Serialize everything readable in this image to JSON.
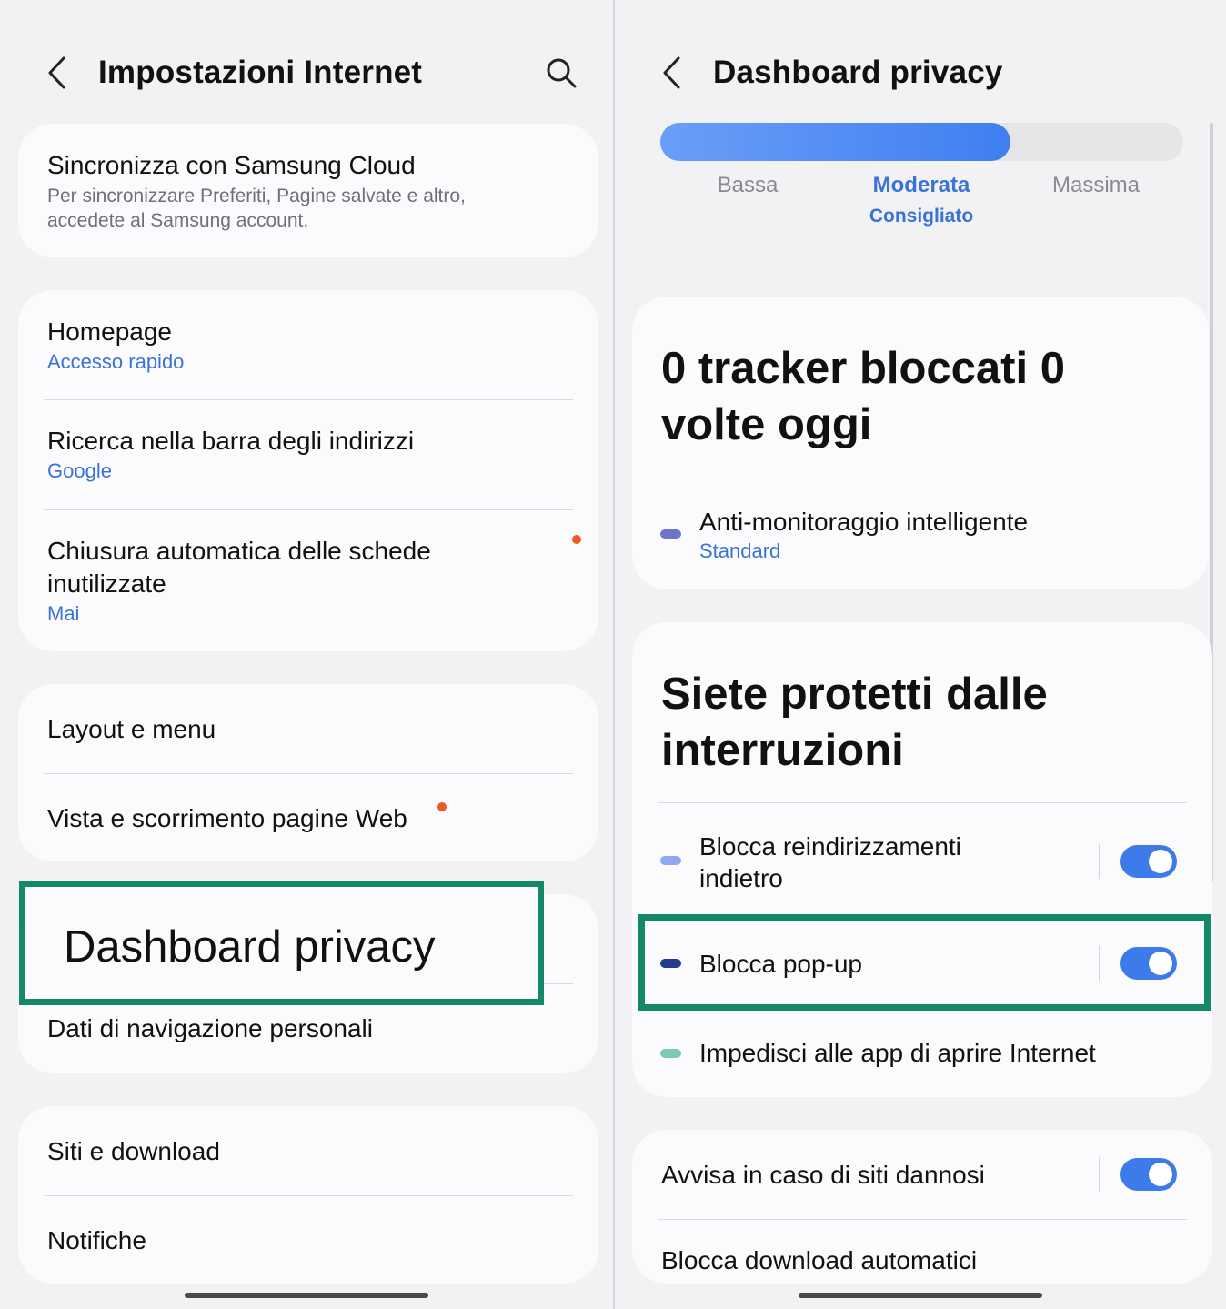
{
  "left": {
    "header": {
      "title": "Impostazioni Internet"
    },
    "sync_card": {
      "title": "Sincronizza con Samsung Cloud",
      "description": "Per sincronizzare Preferiti, Pagine salvate e altro, accedete al Samsung account."
    },
    "general_card": [
      {
        "title": "Homepage",
        "value": "Accesso rapido"
      },
      {
        "title": "Ricerca nella barra degli indirizzi",
        "value": "Google"
      },
      {
        "title_line1": "Chiusura automatica delle schede",
        "title_line2": "inutilizzate",
        "value": "Mai"
      }
    ],
    "layout_card": [
      {
        "title": "Layout e menu"
      },
      {
        "title": "Vista e scorrimento pagine Web"
      }
    ],
    "privacy_card": {
      "dashboard_label": "Dashboard privacy",
      "personal_data_label": "Dati di navigazione personali"
    },
    "sites_card": [
      {
        "title": "Siti e download"
      },
      {
        "title": "Notifiche"
      }
    ]
  },
  "right": {
    "header": {
      "title": "Dashboard privacy"
    },
    "protection_level": {
      "levels": [
        "Bassa",
        "Moderata",
        "Massima"
      ],
      "selected": "Moderata",
      "recommended_label": "Consigliato",
      "fill_fraction": 0.67
    },
    "tracker_card": {
      "headline_line1": "0 tracker bloccati 0",
      "headline_line2": "volte oggi",
      "item_title": "Anti-monitoraggio intelligente",
      "item_value": "Standard"
    },
    "interruptions_card": {
      "headline_line1": "Siete protetti dalle",
      "headline_line2": "interruzioni",
      "items": [
        {
          "title_line1": "Blocca reindirizzamenti",
          "title_line2": "indietro",
          "enabled": true
        },
        {
          "title": "Blocca pop-up",
          "enabled": true
        },
        {
          "title": "Impedisci alle app di aprire Internet"
        }
      ]
    },
    "security_card": {
      "items": [
        {
          "title": "Avvisa in caso di siti dannosi",
          "enabled": true
        },
        {
          "title": "Blocca download automatici"
        }
      ]
    }
  },
  "colors": {
    "accent": "#3c7be9",
    "link": "#3a73d8",
    "highlight": "#14896a",
    "badge": "#e85a26",
    "pill_anti_tracking": "#6b75c9",
    "pill_redirect": "#8fa8f0",
    "pill_popup": "#243a8c",
    "pill_apps": "#7cc9b4"
  },
  "icons": [
    "back-arrow-icon",
    "search-icon"
  ]
}
